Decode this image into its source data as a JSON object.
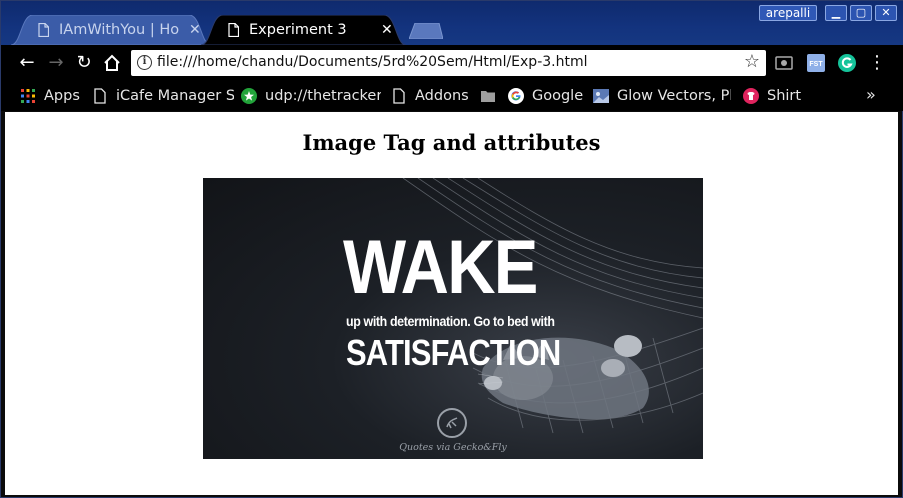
{
  "browser": {
    "tabs": [
      {
        "title": "IAmWithYou | Home",
        "active": false
      },
      {
        "title": "Experiment 3",
        "active": true
      }
    ],
    "user": "arepalli",
    "window_controls": [
      "minimize",
      "maximize",
      "close"
    ],
    "url": "file:///home/chandu/Documents/5rd%20Sem/Html/Exp-3.html",
    "bookmarks": [
      {
        "label": "Apps",
        "icon": "apps-grid-icon"
      },
      {
        "label": "iCafe Manager Se",
        "icon": "page-icon"
      },
      {
        "label": "udp://thetracker",
        "icon": "green-star-icon"
      },
      {
        "label": "Addons",
        "icon": "page-icon"
      },
      {
        "label": "",
        "icon": "folder-icon"
      },
      {
        "label": "Google",
        "icon": "google-icon"
      },
      {
        "label": "Glow Vectors, Ph",
        "icon": "image-icon"
      },
      {
        "label": "Shirt",
        "icon": "shirt-icon"
      }
    ],
    "more_bookmarks": "»",
    "colors": {
      "titlebar": "#13337e",
      "toolbar": "#000000",
      "page": "#ffffff"
    }
  },
  "page": {
    "heading": "Image Tag and attributes",
    "image": {
      "line1": "WAKE",
      "line2": "up with determination. Go to bed with",
      "line3": "SATISFACTION",
      "credit": "Quotes via Gecko&Fly"
    }
  }
}
